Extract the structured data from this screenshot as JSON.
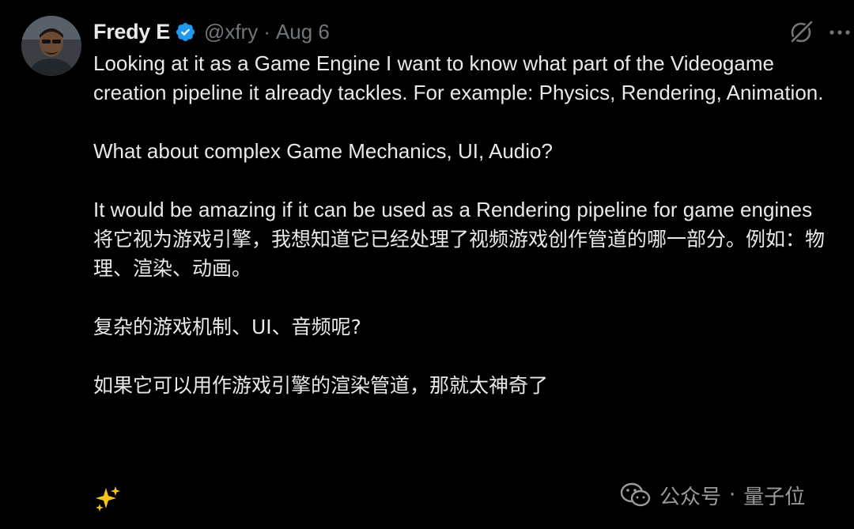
{
  "author": {
    "display_name": "Fredy E",
    "handle": "@xfry",
    "separator": "·",
    "date": "Aug 6",
    "verified": true,
    "avatar_icon": "avatar-photo"
  },
  "actions": {
    "grok_icon": "grok-icon",
    "more_icon": "more-icon"
  },
  "tweet": {
    "en_p1": "Looking at it as a Game Engine I want to know what part of the Videogame creation pipeline it already tackles. For example: Physics, Rendering, Animation.",
    "en_p2": "What about complex Game Mechanics, UI, Audio?",
    "en_p3": "It would be amazing if it can be used as a Rendering pipeline for game engines",
    "zh_p1": "将它视为游戏引擎，我想知道它已经处理了视频游戏创作管道的哪一部分。例如：物理、渲染、动画。",
    "zh_p2": "复杂的游戏机制、UI、音频呢?",
    "zh_p3": "如果它可以用作游戏引擎的渲染管道，那就太神奇了",
    "emoji": "✨"
  },
  "watermark": {
    "source": "公众号",
    "separator": "·",
    "name": "量子位"
  },
  "colors": {
    "background": "#000000",
    "text": "#e7e9ea",
    "muted": "#71767b",
    "verified": "#1d9bf0",
    "watermark": "#9a9a9a"
  }
}
